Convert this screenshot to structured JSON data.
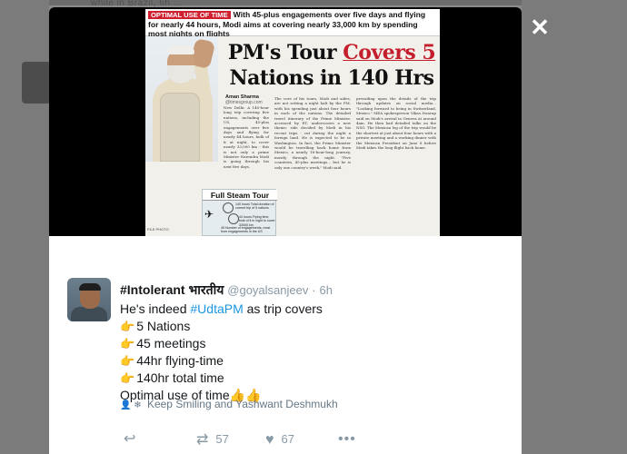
{
  "background": {
    "top_text": "while in Brazil, 6h ..."
  },
  "modal": {
    "close_glyph": "✕"
  },
  "clipping": {
    "tag": "OPTIMAL USE OF TIME",
    "headline_strip": "With 45-plus engagements over five days and flying for nearly 44 hours, Modi aims at covering nearly 33,000 km by spending most nights on flights",
    "title_part1": "PM's Tour ",
    "title_highlight": "Covers 5",
    "title_part2": "Nations in 140 Hrs",
    "byline_name": "Aman Sharma",
    "byline_sub": "@timesgroup.com",
    "col1": "New Delhi: A 140-hour long trip covering five nations, including the US, 45-plus engagements over five days and flying for nearly 44 hours, bulk of it at night, to cover nearly 33,000 km - this is not only a prime Minister Narendra Modi is going through his next five days.",
    "col2": "The core of his tours, Modi and aides, are not setting a night halt by the PM, with his spending just about four hours in each of the nations. The detailed travel itinerary of the Prime Minister, accessed by ET, underscores a new theme: ride decided by Modi in his recent trips - cut during the night a foreign land. He is expected to be in Washington. In fact, the Prime Minister would be travelling back home from Mexico, a nearly 16-hour-long journey, mostly through the night. \"Five countries, 45-plus meetings... but he is only one country's week,\" Modi said.",
    "col3": "prevailing upon the details of the trip through updates on social media... \"Looking forward to being in Switzerland, Mexico.\" MEA spokesperson Vikas Swarup said on Modi's arrival in Geneva at around 4am. He then had detailed talks on the NSG. The Mexican leg of the trip would be the shortest at just about four hours with a private meeting and a working dinner with the Mexican President on June 8 before Modi takes the long flight back home.",
    "box_title": "Full Steam Tour",
    "stat1": "140 hours Total duration of current trip of 5 nations",
    "stat2": "44 hours Flying time, bulk of it in night to cover 33000 km",
    "stat3": "45 Number of engagements, most from engagements in the US",
    "photo_credit": "FILE PHOTO"
  },
  "tweet": {
    "name": "#Intolerant भारतीय",
    "handle": "@goyalsanjeev",
    "separator": "·",
    "time": "6h",
    "line1_prefix": "He's indeed ",
    "line1_hashtag": "#UdtaPM",
    "line1_suffix": " as trip covers",
    "items": [
      "5 Nations",
      "45 meetings",
      "44hr flying-time",
      "140hr total time"
    ],
    "last_line": "Optimal use of time",
    "point_emoji": "👉",
    "thumbs_emoji": "👍👍",
    "retweeted_by": "Keep Smiling and Yashwant Deshmukh",
    "retweets": "57",
    "likes": "67"
  }
}
